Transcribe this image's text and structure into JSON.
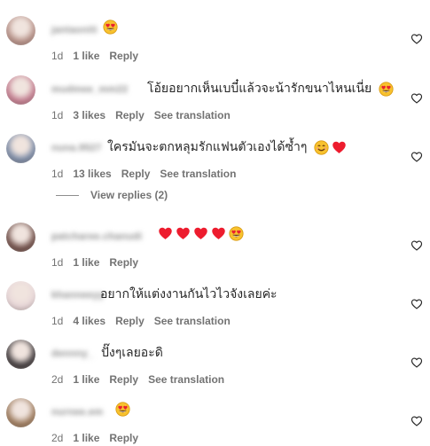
{
  "comments": [
    {
      "username": "jantaoniti",
      "text": "",
      "emojis": [
        "heart-eyes"
      ],
      "time": "1d",
      "likes": "1 like",
      "reply": "Reply",
      "translate": "",
      "avatar_color": "#b58f86"
    },
    {
      "username": "mudmee_mm22",
      "text": "โอ้ยอยากเห็นเบบี๋แล้วจะน้ารักขนาไหนเนี่ย",
      "emojis": [
        "heart-eyes"
      ],
      "time": "1d",
      "likes": "3 likes",
      "reply": "Reply",
      "translate": "See translation",
      "avatar_color": "#c27b8e"
    },
    {
      "username": "nuna.9527",
      "text": "ใครมันจะตกหลุมรักแฟนตัวเองได้ซ้ำๆ",
      "emojis": [
        "smile",
        "heart"
      ],
      "time": "1d",
      "likes": "13 likes",
      "reply": "Reply",
      "translate": "See translation",
      "avatar_color": "#7a8aa6"
    },
    {
      "username": "patcharee.chanudi",
      "text": "",
      "emojis": [
        "heart",
        "heart",
        "heart",
        "heart",
        "heart-eyes"
      ],
      "time": "1d",
      "likes": "1 like",
      "reply": "Reply",
      "translate": "",
      "avatar_color": "#6e4d47"
    },
    {
      "username": "khanneeyy",
      "text": "อยากให้แต่งงานกันไวไวจังเลยค่ะ",
      "emojis": [],
      "time": "1d",
      "likes": "4 likes",
      "reply": "Reply",
      "translate": "See translation",
      "avatar_color": "#e7d6d8"
    },
    {
      "username": "dennny_",
      "text": "ปั๊งๆเลยอะดิ",
      "emojis": [],
      "time": "2d",
      "likes": "1 like",
      "reply": "Reply",
      "translate": "See translation",
      "avatar_color": "#3f3a3c"
    },
    {
      "username": "nurnee.em",
      "text": "",
      "emojis": [
        "heart-eyes"
      ],
      "time": "2d",
      "likes": "1 like",
      "reply": "Reply",
      "translate": "",
      "avatar_color": "#9c7a5c"
    }
  ],
  "view_replies": "View replies (2)",
  "colors": {
    "text": "#262626",
    "meta": "#737373",
    "heart_red": "#ed1c2e",
    "emoji_yellow": "#f8c22e"
  }
}
